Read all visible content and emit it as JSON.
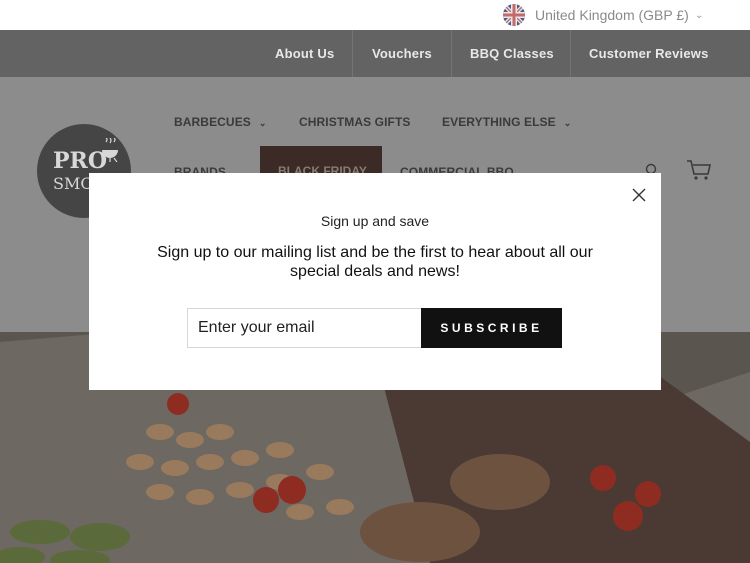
{
  "country_selector": {
    "label": "United Kingdom (GBP £)"
  },
  "top_nav": {
    "items": [
      "About Us",
      "Vouchers",
      "BBQ Classes",
      "Customer Reviews"
    ]
  },
  "main_nav": {
    "barbecues": "BARBECUES",
    "christmas_gifts": "CHRISTMAS GIFTS",
    "everything_else": "EVERYTHING ELSE",
    "brands": "BRANDS",
    "black_friday": "BLACK FRIDAY",
    "commercial_bbq": "COMMERCIAL BBQ"
  },
  "logo": {
    "line1": "PRO",
    "line2": "SMO"
  },
  "modal": {
    "subtitle": "Sign up and save",
    "title": "Sign up to our mailing list and be the first to hear about all our special deals and news!",
    "email_placeholder": "Enter your email",
    "subscribe_label": "SUBSCRIBE"
  },
  "icons": {
    "flag": "uk-flag-icon",
    "search": "search-icon",
    "cart": "cart-icon",
    "close": "close-icon"
  },
  "colors": {
    "top_nav_bg": "#636363",
    "overlay_header": "#8c8c8c",
    "subscribe_bg": "#111111",
    "black_friday_bg": "#3b2a26"
  }
}
